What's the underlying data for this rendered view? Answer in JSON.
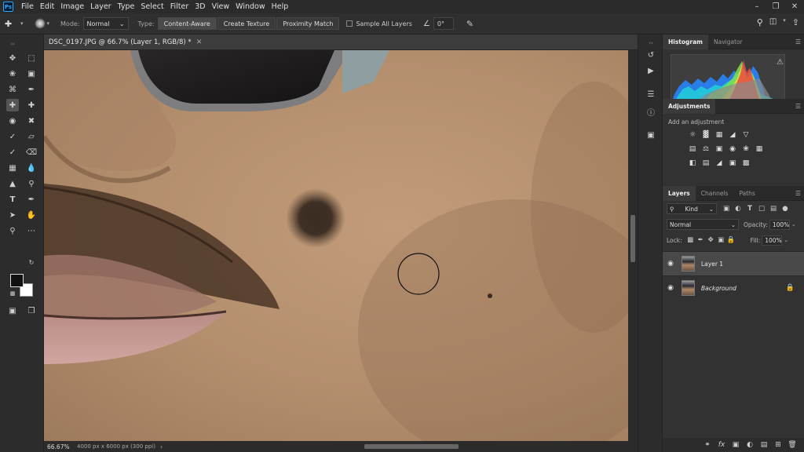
{
  "app": {
    "logo": "Ps"
  },
  "menu": [
    "File",
    "Edit",
    "Image",
    "Layer",
    "Type",
    "Select",
    "Filter",
    "3D",
    "View",
    "Window",
    "Help"
  ],
  "options": {
    "brush_size": "136",
    "mode_label": "Mode:",
    "mode_value": "Normal",
    "type_label": "Type:",
    "type_buttons": [
      "Content-Aware",
      "Create Texture",
      "Proximity Match"
    ],
    "sample_all_layers": "Sample All Layers",
    "angle_value": "0°"
  },
  "document": {
    "tab_title": "DSC_0197.JPG @ 66.7% (Layer 1, RGB/8) *",
    "zoom": "66.67%",
    "info": "4000 px x 6000 px (300 ppi)"
  },
  "panels": {
    "histogram_tabs": [
      "Histogram",
      "Navigator"
    ],
    "adjustments_title": "Adjustments",
    "add_adjustment": "Add an adjustment",
    "layers_tabs": [
      "Layers",
      "Channels",
      "Paths"
    ],
    "kind": "Kind",
    "blend_mode": "Normal",
    "opacity_label": "Opacity:",
    "opacity_value": "100%",
    "lock_label": "Lock:",
    "fill_label": "Fill:",
    "fill_value": "100%",
    "layers": [
      {
        "name": "Layer 1"
      },
      {
        "name": "Background"
      }
    ]
  },
  "colors": {
    "foreground": "#111111",
    "background": "#ffffff",
    "accent": "#31a8ff"
  }
}
